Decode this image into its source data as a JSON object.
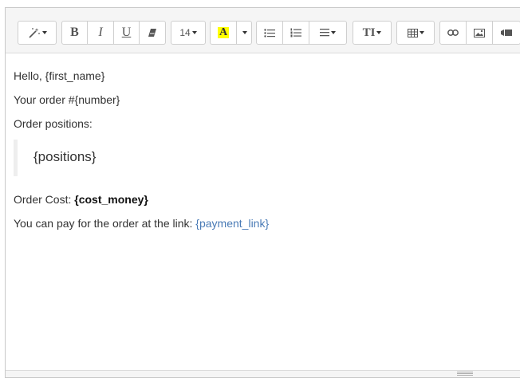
{
  "toolbar": {
    "font_size_label": "14",
    "bold_label": "B",
    "italic_label": "I",
    "underline_label": "U",
    "font_color_label": "A",
    "text_style_label": "TI",
    "highlight_color": "#ffff00",
    "icons": [
      "magic-wand-icon",
      "bold-icon",
      "italic-icon",
      "underline-icon",
      "eraser-icon",
      "font-size-dropdown",
      "font-color-icon",
      "caret-down-icon",
      "bullet-list-icon",
      "numbered-list-icon",
      "align-icon",
      "text-height-icon",
      "table-icon",
      "link-icon",
      "image-icon",
      "video-icon"
    ]
  },
  "content": {
    "line1": "Hello, {first_name}",
    "line2": "Your order #{number}",
    "line3": "Order positions:",
    "quote": "{positions}",
    "cost_prefix": "Order Cost: ",
    "cost_value": "{cost_money}",
    "pay_prefix": "You can pay for the order at the link: ",
    "pay_link": "{payment_link}",
    "link_color": "#4a7bb6"
  }
}
